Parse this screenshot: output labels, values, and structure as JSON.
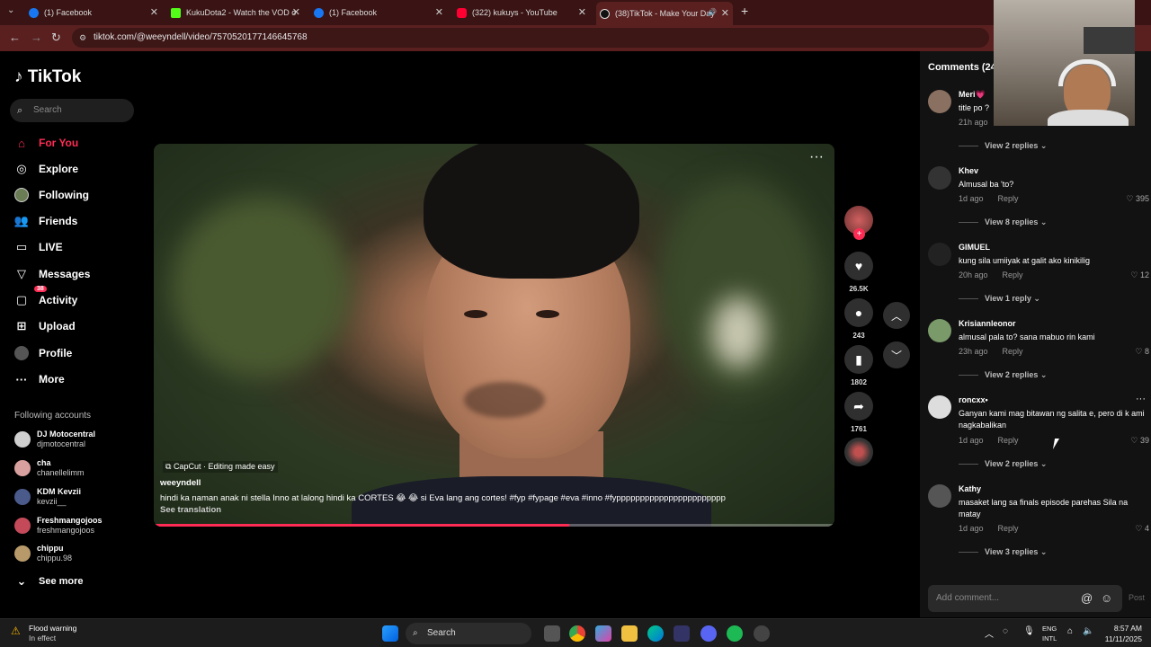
{
  "browser": {
    "tabs": [
      {
        "title": "(1) Facebook",
        "color": "#1877f2"
      },
      {
        "title": "KukuDota2 - Watch the VOD on",
        "color": "#53fc18"
      },
      {
        "title": "(1) Facebook",
        "color": "#1877f2"
      },
      {
        "title": "(322) kukuys - YouTube",
        "color": "#ff0033"
      },
      {
        "title": "(38)TikTok - Make Your Day",
        "color": "#ffffff"
      }
    ],
    "url": "tiktok.com/@weeyndell/video/7570520177146645768"
  },
  "sidebar": {
    "logo": "TikTok",
    "search_placeholder": "Search",
    "nav": [
      {
        "label": "For You",
        "icon": "home-icon"
      },
      {
        "label": "Explore",
        "icon": "compass-icon"
      },
      {
        "label": "Following",
        "icon": "following-icon"
      },
      {
        "label": "Friends",
        "icon": "friends-icon"
      },
      {
        "label": "LIVE",
        "icon": "live-icon"
      },
      {
        "label": "Messages",
        "icon": "messages-icon"
      },
      {
        "label": "Activity",
        "icon": "activity-icon",
        "badge": "38"
      },
      {
        "label": "Upload",
        "icon": "upload-icon"
      },
      {
        "label": "Profile",
        "icon": "profile-icon"
      },
      {
        "label": "More",
        "icon": "more-icon"
      }
    ],
    "following_title": "Following accounts",
    "accounts": [
      {
        "name": "DJ Motocentral",
        "handle": "djmotocentral"
      },
      {
        "name": "cha",
        "handle": "chanellelimm"
      },
      {
        "name": "KDM Kevzii",
        "handle": "kevzii__"
      },
      {
        "name": "Freshmangojoos",
        "handle": "freshmangojoos"
      },
      {
        "name": "chippu",
        "handle": "chippu.98"
      }
    ],
    "see_more": "See more"
  },
  "video": {
    "capcut": "CapCut · Editing made easy",
    "author": "weeyndell",
    "caption": "hindi ka naman anak ni stella Inno at lalong hindi ka CORTES 😂 😂 si Eva lang ang cortes! #fyp #fypage #eva #inno #fyppppppppppppppppppppppp",
    "see_translation": "See translation",
    "progress": 0.61
  },
  "actions": {
    "likes": "26.5K",
    "comments": "243",
    "saves": "1802",
    "shares": "1761"
  },
  "comments": {
    "header": "Comments (243)",
    "items": [
      {
        "user": "Meri💗",
        "text": "title po ?",
        "time": "21h ago",
        "likes": "",
        "replies": "View 2 replies"
      },
      {
        "user": "Khev",
        "text": "Almusal ba 'to?",
        "time": "1d ago",
        "likes": "395",
        "replies": "View 8 replies"
      },
      {
        "user": "GIMUEL",
        "text": "kung sila umiiyak at galit ako kinikilig",
        "time": "20h ago",
        "likes": "12",
        "replies": "View 1 reply"
      },
      {
        "user": "Krisiannleonor",
        "text": "almusal pala to? sana mabuo rin kami",
        "time": "23h ago",
        "likes": "8",
        "replies": "View 2 replies"
      },
      {
        "user": "roncxx•",
        "text": "Ganyan kami mag bitawan ng salita e, pero di k ami nagkabalikan",
        "time": "1d ago",
        "likes": "39",
        "replies": "View 2 replies"
      },
      {
        "user": "Kathy",
        "text": "masaket lang sa finals episode parehas Sila na matay",
        "time": "1d ago",
        "likes": "4",
        "replies": "View 3 replies"
      }
    ],
    "reply_label": "Reply",
    "add_placeholder": "Add comment...",
    "post_label": "Post"
  },
  "taskbar": {
    "weather_title": "Flood warning",
    "weather_sub": "In effect",
    "search": "Search",
    "lang1": "ENG",
    "lang2": "INTL",
    "time": "8:57 AM",
    "date": "11/11/2025"
  }
}
